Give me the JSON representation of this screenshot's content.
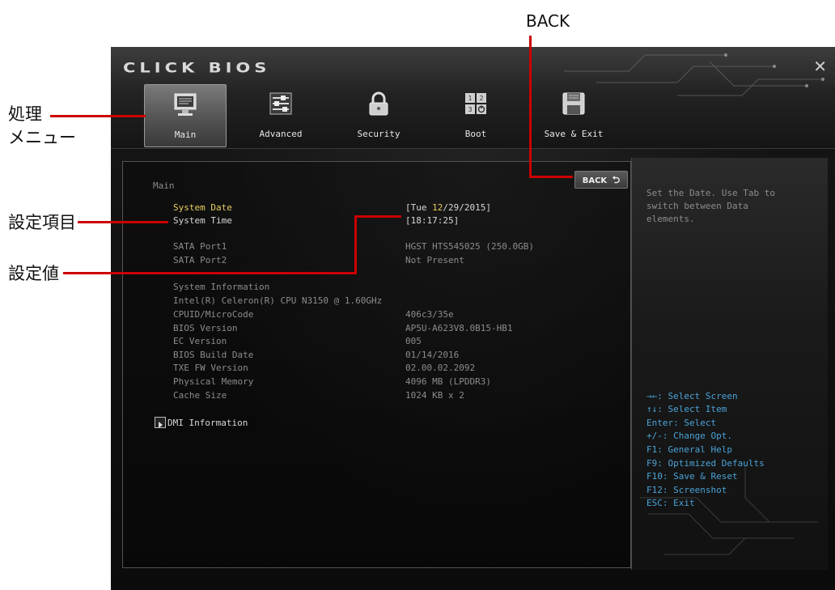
{
  "annotations": {
    "menu_line1": "処理",
    "menu_line2": "メニュー",
    "settings_item": "設定項目",
    "settings_value": "設定値",
    "back": "BACK"
  },
  "window": {
    "logo": "CLICK BIOS",
    "close": "✕"
  },
  "tabs": [
    {
      "label": "Main",
      "icon": "monitor-icon",
      "active": true
    },
    {
      "label": "Advanced",
      "icon": "sliders-icon",
      "active": false
    },
    {
      "label": "Security",
      "icon": "lock-icon",
      "active": false
    },
    {
      "label": "Boot",
      "icon": "boot-order-icon",
      "active": false
    },
    {
      "label": "Save & Exit",
      "icon": "floppy-disk-icon",
      "active": false
    }
  ],
  "main": {
    "section_title": "Main",
    "back_label": "BACK",
    "back_glyph": "⮌",
    "rows": [
      {
        "label": "System Date",
        "value_prefix": "[Tue ",
        "value_highlight": "12",
        "value_suffix": "/29/2015]"
      },
      {
        "label": "System Time",
        "value": "[18:17:25]"
      },
      {
        "label": "SATA Port1",
        "value": "HGST HTS545025 (250.0GB)"
      },
      {
        "label": "SATA Port2",
        "value": "Not Present"
      }
    ],
    "system_information_heading": "System Information",
    "cpu": "Intel(R) Celeron(R) CPU N3150 @ 1.60GHz",
    "info_rows": [
      {
        "label": "CPUID/MicroCode",
        "value": "406c3/35e"
      },
      {
        "label": "BIOS Version",
        "value": "AP5U-A623V8.0B15-HB1"
      },
      {
        "label": "EC Version",
        "value": "005"
      },
      {
        "label": "BIOS Build Date",
        "value": "01/14/2016"
      },
      {
        "label": "TXE FW Version",
        "value": "02.00.02.2092"
      },
      {
        "label": "Physical Memory",
        "value": "4096 MB (LPDDR3)"
      },
      {
        "label": "Cache Size",
        "value": "1024 KB x 2"
      }
    ],
    "dmi_label": "DMI Information"
  },
  "help": {
    "description": [
      "Set the Date. Use Tab to",
      "switch between Data",
      "elements."
    ],
    "keys": [
      "→←: Select Screen",
      "↑↓: Select Item",
      "Enter: Select",
      "+/-: Change Opt.",
      "F1: General Help",
      "F9: Optimized Defaults",
      "F10: Save & Reset",
      "F12: Screenshot",
      "ESC: Exit"
    ]
  },
  "colors": {
    "accent_yellow": "#e8d060",
    "help_blue": "#4aa3d8",
    "annotation_red": "#cc0000"
  }
}
